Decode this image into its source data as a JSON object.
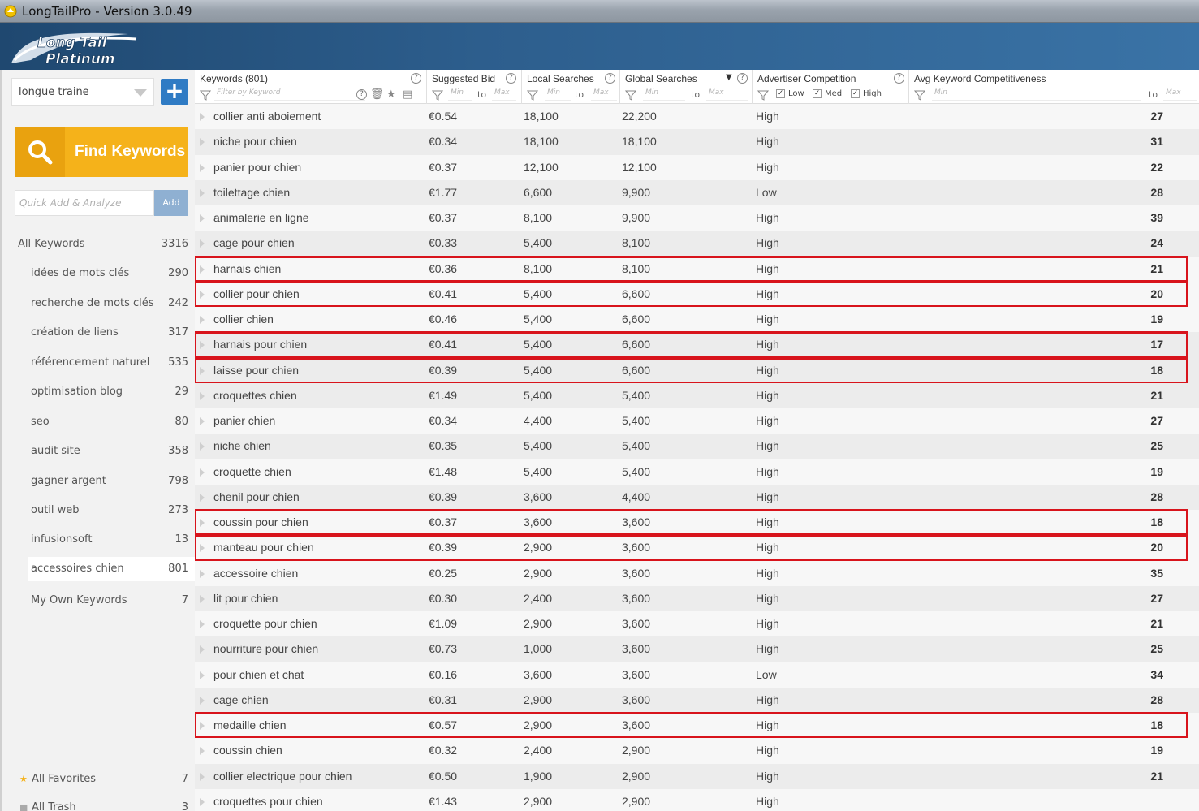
{
  "window": {
    "title": "LongTailPro - Version 3.0.49"
  },
  "logo": {
    "line1": "Long Tail",
    "line2": "Platinum"
  },
  "sidebar": {
    "project": "longue traine",
    "add_project_icon": "plus-icon",
    "find_keywords_label": "Find Keywords",
    "quick_add_placeholder": "Quick Add & Analyze",
    "add_label": "Add",
    "items": [
      {
        "name": "All Keywords",
        "count": "3316"
      },
      {
        "name": "idées de mots clés",
        "count": "290"
      },
      {
        "name": "recherche de mots clés",
        "count": "242"
      },
      {
        "name": "création de liens",
        "count": "317"
      },
      {
        "name": "référencement naturel",
        "count": "535"
      },
      {
        "name": "optimisation blog",
        "count": "29"
      },
      {
        "name": "seo",
        "count": "80"
      },
      {
        "name": "audit site",
        "count": "358"
      },
      {
        "name": "gagner argent",
        "count": "798"
      },
      {
        "name": "outil web",
        "count": "273"
      },
      {
        "name": "infusionsoft",
        "count": "13"
      },
      {
        "name": "accessoires chien",
        "count": "801"
      },
      {
        "name": "My Own Keywords",
        "count": "7"
      }
    ],
    "favorites": {
      "name": "All Favorites",
      "count": "7"
    },
    "trash": {
      "name": "All Trash",
      "count": "3"
    }
  },
  "columns": {
    "keywords": {
      "title": "Keywords (801)",
      "filter_placeholder": "Filter by Keyword"
    },
    "bid": {
      "title": "Suggested Bid",
      "min": "Min",
      "to": "to",
      "max": "Max"
    },
    "local": {
      "title": "Local Searches",
      "min": "Min",
      "to": "to",
      "max": "Max"
    },
    "global": {
      "title": "Global Searches",
      "sort": "▼",
      "min": "Min",
      "to": "to",
      "max": "Max"
    },
    "competition": {
      "title": "Advertiser Competition",
      "low": "Low",
      "med": "Med",
      "high": "High"
    },
    "akc": {
      "title": "Avg Keyword Competitiveness",
      "min": "Min",
      "to": "to",
      "max": "Max"
    }
  },
  "rows": [
    {
      "kw": "collier anti aboiement",
      "bid": "€0.54",
      "local": "18,100",
      "global": "22,200",
      "comp": "High",
      "akc": "27",
      "hl": false
    },
    {
      "kw": "niche pour chien",
      "bid": "€0.34",
      "local": "18,100",
      "global": "18,100",
      "comp": "High",
      "akc": "31",
      "hl": false
    },
    {
      "kw": "panier pour chien",
      "bid": "€0.37",
      "local": "12,100",
      "global": "12,100",
      "comp": "High",
      "akc": "22",
      "hl": false
    },
    {
      "kw": "toilettage chien",
      "bid": "€1.77",
      "local": "6,600",
      "global": "9,900",
      "comp": "Low",
      "akc": "28",
      "hl": false
    },
    {
      "kw": "animalerie en ligne",
      "bid": "€0.37",
      "local": "8,100",
      "global": "9,900",
      "comp": "High",
      "akc": "39",
      "hl": false
    },
    {
      "kw": "cage pour chien",
      "bid": "€0.33",
      "local": "5,400",
      "global": "8,100",
      "comp": "High",
      "akc": "24",
      "hl": false
    },
    {
      "kw": "harnais chien",
      "bid": "€0.36",
      "local": "8,100",
      "global": "8,100",
      "comp": "High",
      "akc": "21",
      "hl": true
    },
    {
      "kw": "collier pour chien",
      "bid": "€0.41",
      "local": "5,400",
      "global": "6,600",
      "comp": "High",
      "akc": "20",
      "hl": true
    },
    {
      "kw": "collier chien",
      "bid": "€0.46",
      "local": "5,400",
      "global": "6,600",
      "comp": "High",
      "akc": "19",
      "hl": false
    },
    {
      "kw": "harnais pour chien",
      "bid": "€0.41",
      "local": "5,400",
      "global": "6,600",
      "comp": "High",
      "akc": "17",
      "hl": true
    },
    {
      "kw": "laisse pour chien",
      "bid": "€0.39",
      "local": "5,400",
      "global": "6,600",
      "comp": "High",
      "akc": "18",
      "hl": true
    },
    {
      "kw": "croquettes chien",
      "bid": "€1.49",
      "local": "5,400",
      "global": "5,400",
      "comp": "High",
      "akc": "21",
      "hl": false
    },
    {
      "kw": "panier chien",
      "bid": "€0.34",
      "local": "4,400",
      "global": "5,400",
      "comp": "High",
      "akc": "27",
      "hl": false
    },
    {
      "kw": "niche chien",
      "bid": "€0.35",
      "local": "5,400",
      "global": "5,400",
      "comp": "High",
      "akc": "25",
      "hl": false
    },
    {
      "kw": "croquette chien",
      "bid": "€1.48",
      "local": "5,400",
      "global": "5,400",
      "comp": "High",
      "akc": "19",
      "hl": false
    },
    {
      "kw": "chenil pour chien",
      "bid": "€0.39",
      "local": "3,600",
      "global": "4,400",
      "comp": "High",
      "akc": "28",
      "hl": false
    },
    {
      "kw": "coussin pour chien",
      "bid": "€0.37",
      "local": "3,600",
      "global": "3,600",
      "comp": "High",
      "akc": "18",
      "hl": true
    },
    {
      "kw": "manteau pour chien",
      "bid": "€0.39",
      "local": "2,900",
      "global": "3,600",
      "comp": "High",
      "akc": "20",
      "hl": true
    },
    {
      "kw": "accessoire chien",
      "bid": "€0.25",
      "local": "2,900",
      "global": "3,600",
      "comp": "High",
      "akc": "35",
      "hl": false
    },
    {
      "kw": "lit pour chien",
      "bid": "€0.30",
      "local": "2,400",
      "global": "3,600",
      "comp": "High",
      "akc": "27",
      "hl": false
    },
    {
      "kw": "croquette pour chien",
      "bid": "€1.09",
      "local": "2,900",
      "global": "3,600",
      "comp": "High",
      "akc": "21",
      "hl": false
    },
    {
      "kw": "nourriture pour chien",
      "bid": "€0.73",
      "local": "1,000",
      "global": "3,600",
      "comp": "High",
      "akc": "25",
      "hl": false
    },
    {
      "kw": "pour chien et chat",
      "bid": "€0.16",
      "local": "3,600",
      "global": "3,600",
      "comp": "Low",
      "akc": "34",
      "hl": false
    },
    {
      "kw": "cage chien",
      "bid": "€0.31",
      "local": "2,900",
      "global": "3,600",
      "comp": "High",
      "akc": "28",
      "hl": false
    },
    {
      "kw": "medaille chien",
      "bid": "€0.57",
      "local": "2,900",
      "global": "3,600",
      "comp": "High",
      "akc": "18",
      "hl": true
    },
    {
      "kw": "coussin chien",
      "bid": "€0.32",
      "local": "2,400",
      "global": "2,900",
      "comp": "High",
      "akc": "19",
      "hl": false
    },
    {
      "kw": "collier electrique pour chien",
      "bid": "€0.50",
      "local": "1,900",
      "global": "2,900",
      "comp": "High",
      "akc": "21",
      "hl": false
    },
    {
      "kw": "croquettes pour chien",
      "bid": "€1.43",
      "local": "2,900",
      "global": "2,900",
      "comp": "High",
      "akc": "",
      "hl": false
    }
  ],
  "colors": {
    "highlight": "#d8141c",
    "find_button": "#f5b21a",
    "header_band": "#2d5e8d",
    "add_button": "#2f7bc4"
  }
}
